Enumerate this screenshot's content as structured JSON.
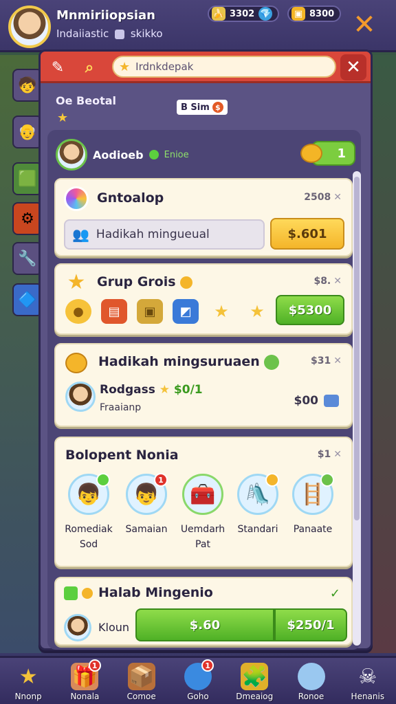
{
  "player": {
    "name": "Mnmiriiopsian",
    "subtitle_left": "Indaiiastic",
    "subtitle_right": "skikko"
  },
  "currencies": [
    {
      "icon": "banana-icon",
      "value": "3302"
    },
    {
      "icon": "gold-crate-icon",
      "value": "8300"
    }
  ],
  "search": {
    "placeholder": "Irdnkdepak"
  },
  "section": {
    "title": "Oe Beotal",
    "tab_label": "B Sim"
  },
  "inner": {
    "header_name": "Aodioeb",
    "header_status": "Enioe",
    "coin_value": "1"
  },
  "cards": {
    "gift": {
      "title": "Gntoalop",
      "price": "2508",
      "field_label": "Hadikah mingueual",
      "button_label": "$.601"
    },
    "group": {
      "title": "Grup Grois",
      "price": "$8.",
      "button_label": "$5300",
      "items": [
        "gold-coin-icon",
        "red-chest-icon",
        "gold-crate-icon",
        "blue-box-icon",
        "star-icon",
        "star-icon"
      ]
    },
    "hadikah": {
      "title": "Hadikah mingsuruaen",
      "price": "$31",
      "user_name": "Rodgass",
      "user_amount": "$0/1",
      "user_sub": "Fraaianp",
      "right_amount": "$00"
    },
    "bolopent": {
      "title": "Bolopent Nonia",
      "price": "$1",
      "characters": [
        {
          "label": "Romediak Sod",
          "badge": "",
          "icon": "boy-avatar-icon"
        },
        {
          "label": "Samaian",
          "badge": "1",
          "icon": "boy-avatar-icon"
        },
        {
          "label": "Uemdarh Pat",
          "badge": "",
          "icon": "treasure-chest-icon"
        },
        {
          "label": "Standari",
          "badge": "",
          "icon": "golden-slide-icon"
        },
        {
          "label": "Panaate",
          "badge": "",
          "icon": "wooden-ladder-icon"
        }
      ]
    },
    "halab": {
      "title": "Halab Mingenio",
      "user_name": "Kloun",
      "btn_left": "$.60",
      "btn_right": "$250/1"
    }
  },
  "nav": [
    {
      "label": "Nnonp",
      "icon": "star-icon",
      "badge": ""
    },
    {
      "label": "Nonala",
      "icon": "gift-box-icon",
      "badge": "1"
    },
    {
      "label": "Comoe",
      "icon": "crate-icon",
      "badge": ""
    },
    {
      "label": "Goho",
      "icon": "blue-orb-icon",
      "badge": "1"
    },
    {
      "label": "Dmeaiog",
      "icon": "puzzle-icon",
      "badge": ""
    },
    {
      "label": "Ronoe",
      "icon": "bubble-icon",
      "badge": ""
    },
    {
      "label": "Henanis",
      "icon": "skull-icon",
      "badge": ""
    }
  ],
  "colors": {
    "accent_red": "#d9473a",
    "accent_green": "#4fb126",
    "accent_yellow": "#f4b52a",
    "panel": "#5b5384"
  }
}
